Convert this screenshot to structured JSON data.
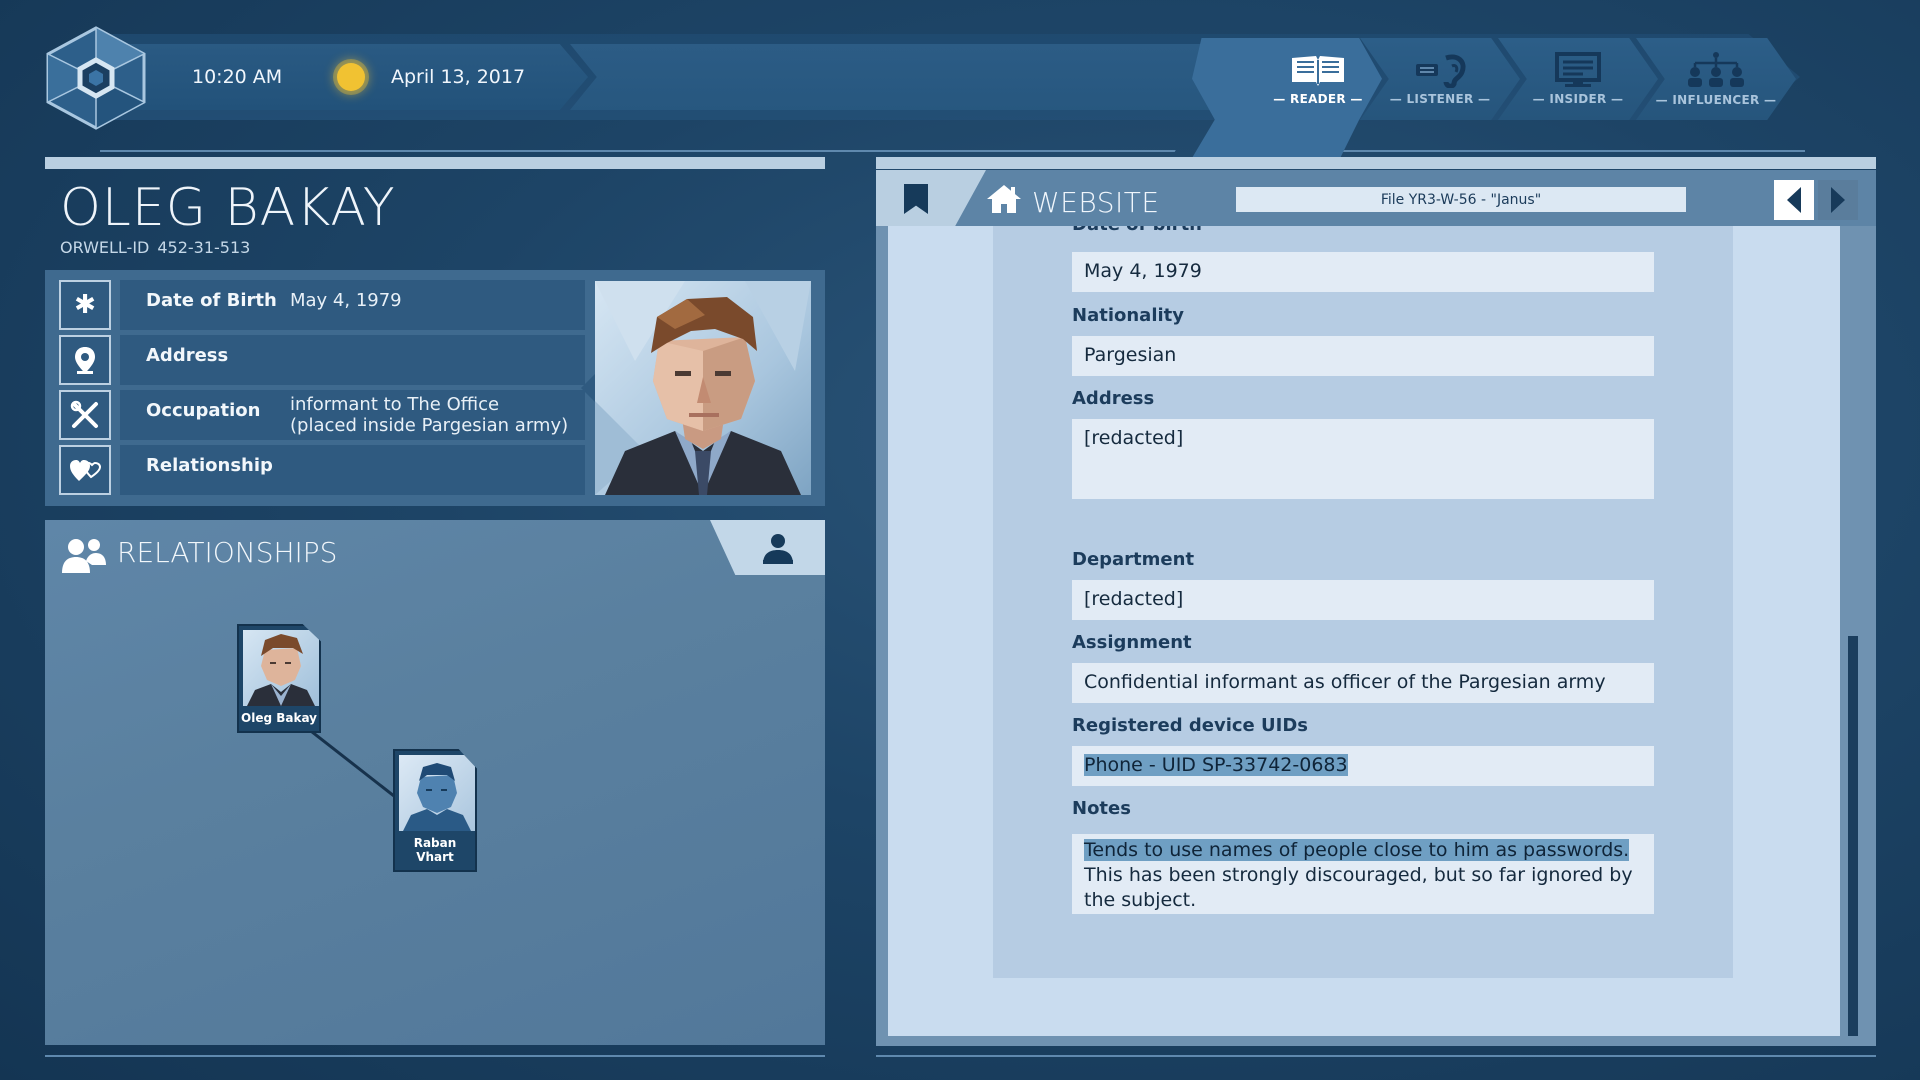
{
  "topbar": {
    "time": "10:20 AM",
    "date": "April 13, 2017",
    "modes": [
      {
        "label": "— READER —",
        "icon": "book-icon",
        "active": true
      },
      {
        "label": "— LISTENER —",
        "icon": "ear-icon",
        "active": false
      },
      {
        "label": "— INSIDER —",
        "icon": "monitor-icon",
        "active": false
      },
      {
        "label": "— INFLUENCER —",
        "icon": "network-icon",
        "active": false
      }
    ]
  },
  "profile": {
    "name": "OLEG BAKAY",
    "orwell_id_label": "ORWELL-ID",
    "orwell_id_value": "452-31-513",
    "rows": [
      {
        "label": "Date of Birth",
        "value": "May 4, 1979",
        "icon": "asterisk-icon"
      },
      {
        "label": "Address",
        "value": "",
        "icon": "location-pin-icon"
      },
      {
        "label": "Occupation",
        "value_line1": "informant to The Office",
        "value_line2": "(placed inside Pargesian army)",
        "icon": "tools-icon"
      },
      {
        "label": "Relationship",
        "value": "",
        "icon": "hearts-icon"
      }
    ]
  },
  "relationships": {
    "title": "RELATIONSHIPS",
    "nodes": [
      {
        "name": "Oleg Bakay"
      },
      {
        "name": "Raban Vhart"
      }
    ]
  },
  "browser": {
    "tab_label": "WEBSITE",
    "file_title": "File YR3-W-56 - \"Janus\"",
    "fields": {
      "dob_label": "Date of birth",
      "dob_value": "May 4, 1979",
      "nationality_label": "Nationality",
      "nationality_value": "Pargesian",
      "address_label": "Address",
      "address_value": "[redacted]",
      "department_label": "Department",
      "department_value": "[redacted]",
      "assignment_label": "Assignment",
      "assignment_value": "Confidential informant as officer of the Pargesian army",
      "devices_label": "Registered device UIDs",
      "devices_value": "Phone - UID SP-33742-0683",
      "notes_label": "Notes",
      "notes_highlight": "Tends to use names of people close to him as passwords.",
      "notes_line2": "This has been strongly discouraged, but so far ignored by",
      "notes_line3": "the subject."
    }
  },
  "colors": {
    "background": "#1d4466",
    "panel": "#3f6a8f",
    "accent_light": "#b9cfe1",
    "highlight": "#6f9fc3",
    "sun": "#f1c232"
  }
}
